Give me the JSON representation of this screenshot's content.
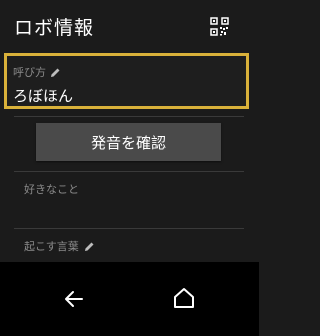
{
  "header": {
    "title": "ロボ情報",
    "qr_icon": "qr-code-icon"
  },
  "nickname": {
    "label": "呼び方",
    "value": "ろぼほん",
    "edit_icon": "pencil-icon"
  },
  "confirm_button": {
    "label": "発音を確認"
  },
  "favorites": {
    "label": "好きなこと"
  },
  "wake_word": {
    "label": "起こす言葉",
    "edit_icon": "pencil-icon"
  },
  "navbar": {
    "back_icon": "back-arrow-icon",
    "home_icon": "home-icon"
  },
  "colors": {
    "highlight": "#d9b13a",
    "background": "#1b1b1b",
    "button": "#4a4a4a"
  }
}
